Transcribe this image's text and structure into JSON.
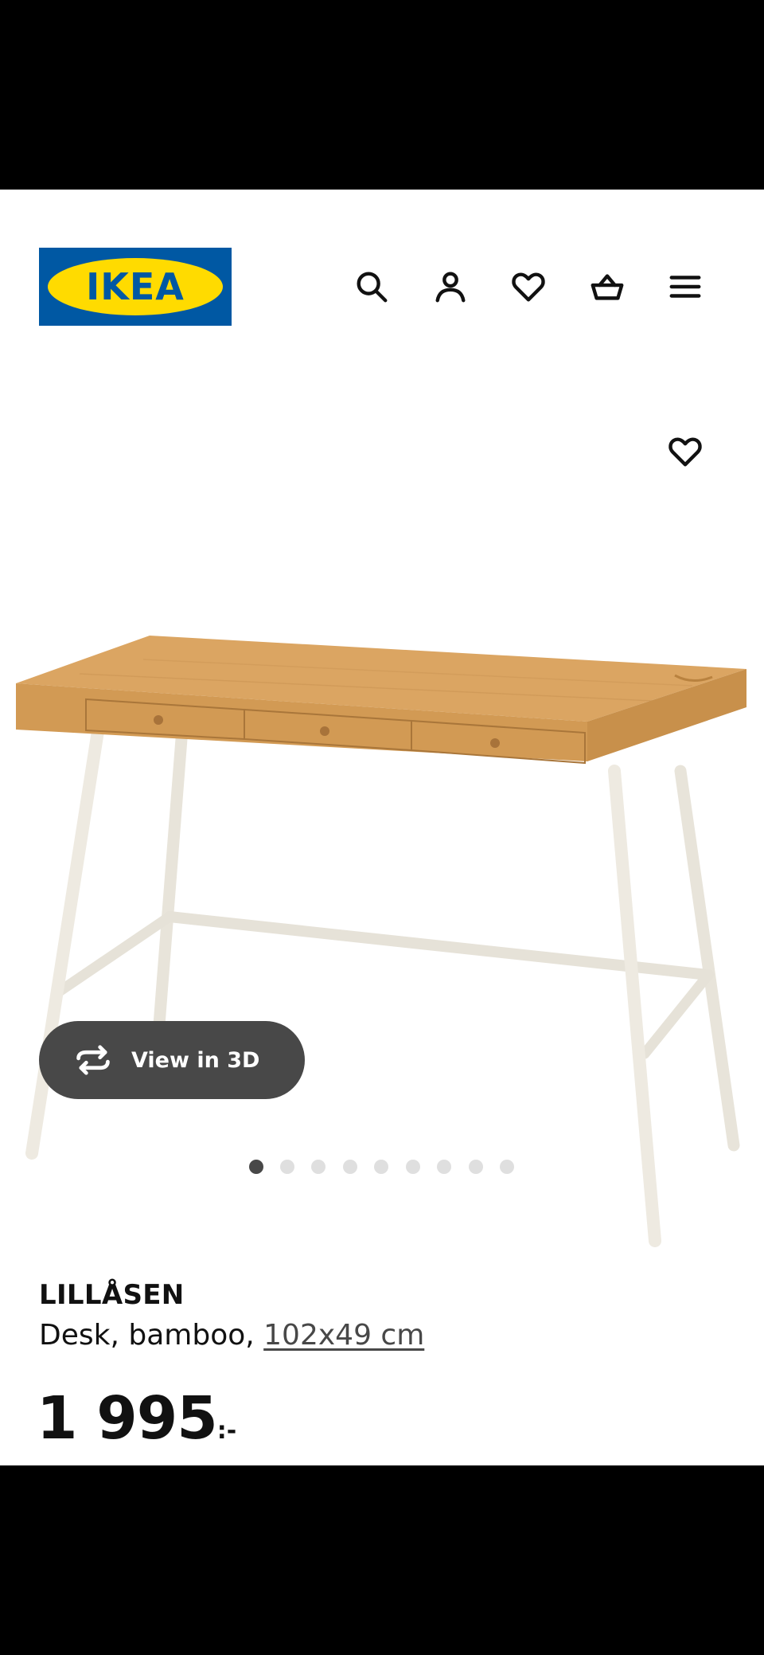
{
  "header": {
    "logo_text": "IKEA",
    "icons": [
      "search-icon",
      "user-icon",
      "heart-icon",
      "basket-icon",
      "menu-icon"
    ]
  },
  "product": {
    "image_alt": "LILLÅSEN desk in bamboo with white legs",
    "view_3d_label": "View in 3D",
    "carousel": {
      "total": 9,
      "active": 1
    },
    "name": "LILLÅSEN",
    "description_prefix": "Desk, bamboo, ",
    "measurement": "102x49 cm",
    "price_integer": "1 995",
    "price_suffix": ":-"
  },
  "colors": {
    "ikea_blue": "#0058a3",
    "ikea_yellow": "#ffdb00",
    "button_dark": "#484848"
  }
}
